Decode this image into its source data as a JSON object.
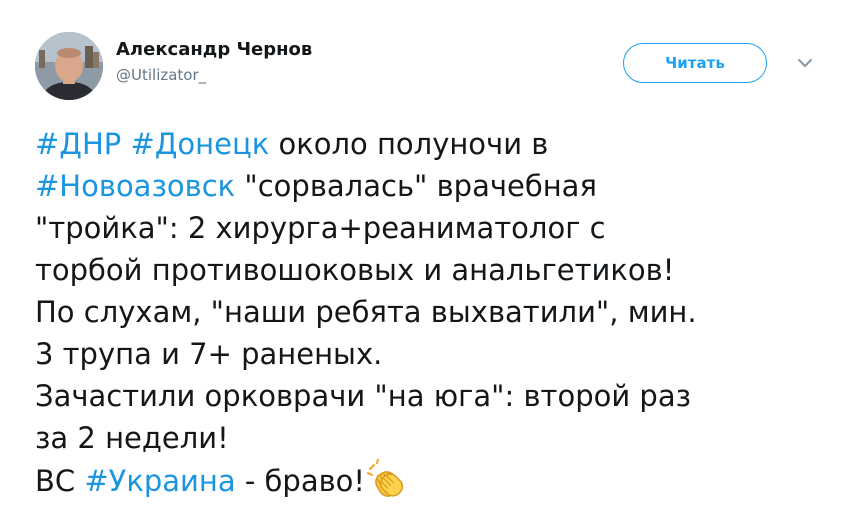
{
  "author": {
    "display_name": "Александр Чернов",
    "handle": "@Utilizator_"
  },
  "follow_button": {
    "label": "Читать"
  },
  "icons": {
    "menu": "chevron-down-icon",
    "emoji": "clapping-hands"
  },
  "colors": {
    "link": "#1b95e0",
    "button": "#1da1f2",
    "text": "#14171a",
    "muted": "#657786"
  },
  "tweet": {
    "line1": {
      "tag1": "#ДНР",
      "tag2": "#Донецк",
      "text": " около полуночи в"
    },
    "line2": {
      "tag": "#Новоазовск",
      "text": " \"сорвалась\" врачебная"
    },
    "line3": "\"тройка\": 2 хирурга+реаниматолог с",
    "line4": "торбой противошоковых и анальгетиков!",
    "line5": "По слухам, \"наши ребята выхватили\", мин.",
    "line6": "3 трупа и 7+ раненых.",
    "line7": "Зачастили орковрачи \"на юга\": второй раз",
    "line8": "за 2 недели!",
    "line9": {
      "prefix": "ВС ",
      "tag": "#Украина",
      "text": " - браво!"
    }
  }
}
